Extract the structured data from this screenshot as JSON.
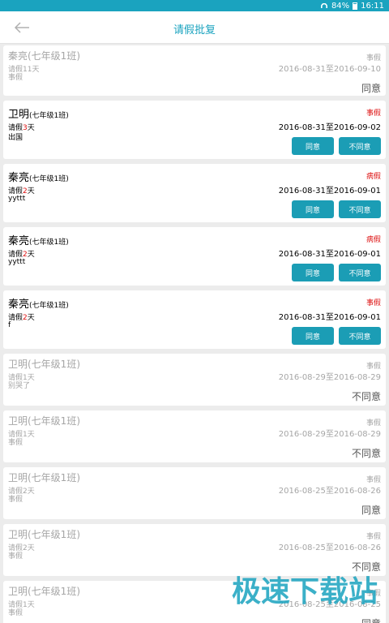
{
  "status": {
    "battery": "84%",
    "time": "16:11"
  },
  "header": {
    "title": "请假批复"
  },
  "watermark": "极速下载站",
  "pending_cards": [
    {
      "name": "卫明",
      "class": "(七年级1班)",
      "days_prefix": "请假",
      "days": "3",
      "days_suffix": "天",
      "reason": "出国",
      "type": "事假",
      "dates": "2016-08-31至2016-09-02",
      "agree": "同意",
      "disagree": "不同意"
    },
    {
      "name": "秦亮",
      "class": "(七年级1班)",
      "days_prefix": "请假",
      "days": "2",
      "days_suffix": "天",
      "reason": "yyttt",
      "type": "病假",
      "dates": "2016-08-31至2016-09-01",
      "agree": "同意",
      "disagree": "不同意"
    },
    {
      "name": "秦亮",
      "class": "(七年级1班)",
      "days_prefix": "请假",
      "days": "2",
      "days_suffix": "天",
      "reason": "yyttt",
      "type": "病假",
      "dates": "2016-08-31至2016-09-01",
      "agree": "同意",
      "disagree": "不同意"
    },
    {
      "name": "秦亮",
      "class": "(七年级1班)",
      "days_prefix": "请假",
      "days": "2",
      "days_suffix": "天",
      "reason": "f",
      "type": "事假",
      "dates": "2016-08-31至2016-09-01",
      "agree": "同意",
      "disagree": "不同意"
    }
  ],
  "done_cards": [
    {
      "name": "秦亮(七年级1班)",
      "days": "请假11天",
      "reason": "事假",
      "type": "事假",
      "dates": "2016-08-31至2016-09-10",
      "result": "同意"
    },
    {
      "name": "卫明(七年级1班)",
      "days": "请假1天",
      "reason": "别哭了",
      "type": "事假",
      "dates": "2016-08-29至2016-08-29",
      "result": "不同意"
    },
    {
      "name": "卫明(七年级1班)",
      "days": "请假1天",
      "reason": "事假",
      "type": "事假",
      "dates": "2016-08-29至2016-08-29",
      "result": "不同意"
    },
    {
      "name": "卫明(七年级1班)",
      "days": "请假2天",
      "reason": "事假",
      "type": "事假",
      "dates": "2016-08-25至2016-08-26",
      "result": "同意"
    },
    {
      "name": "卫明(七年级1班)",
      "days": "请假2天",
      "reason": "事假",
      "type": "事假",
      "dates": "2016-08-25至2016-08-26",
      "result": "不同意"
    },
    {
      "name": "卫明(七年级1班)",
      "days": "请假1天",
      "reason": "事假",
      "type": "事假",
      "dates": "2016-08-25至2016-08-25",
      "result": "同意"
    }
  ]
}
